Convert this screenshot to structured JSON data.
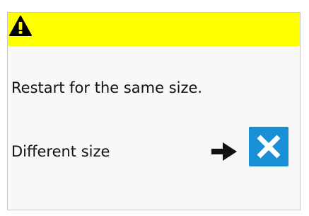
{
  "header": {
    "icon": "warning-triangle-icon",
    "color": "#ffff00"
  },
  "message": {
    "line1": "Restart for the same size.",
    "line2": "Different size"
  },
  "cancel_button": {
    "icon": "close-icon",
    "color": "#1990d6"
  },
  "arrow": {
    "icon": "arrow-right-icon"
  }
}
